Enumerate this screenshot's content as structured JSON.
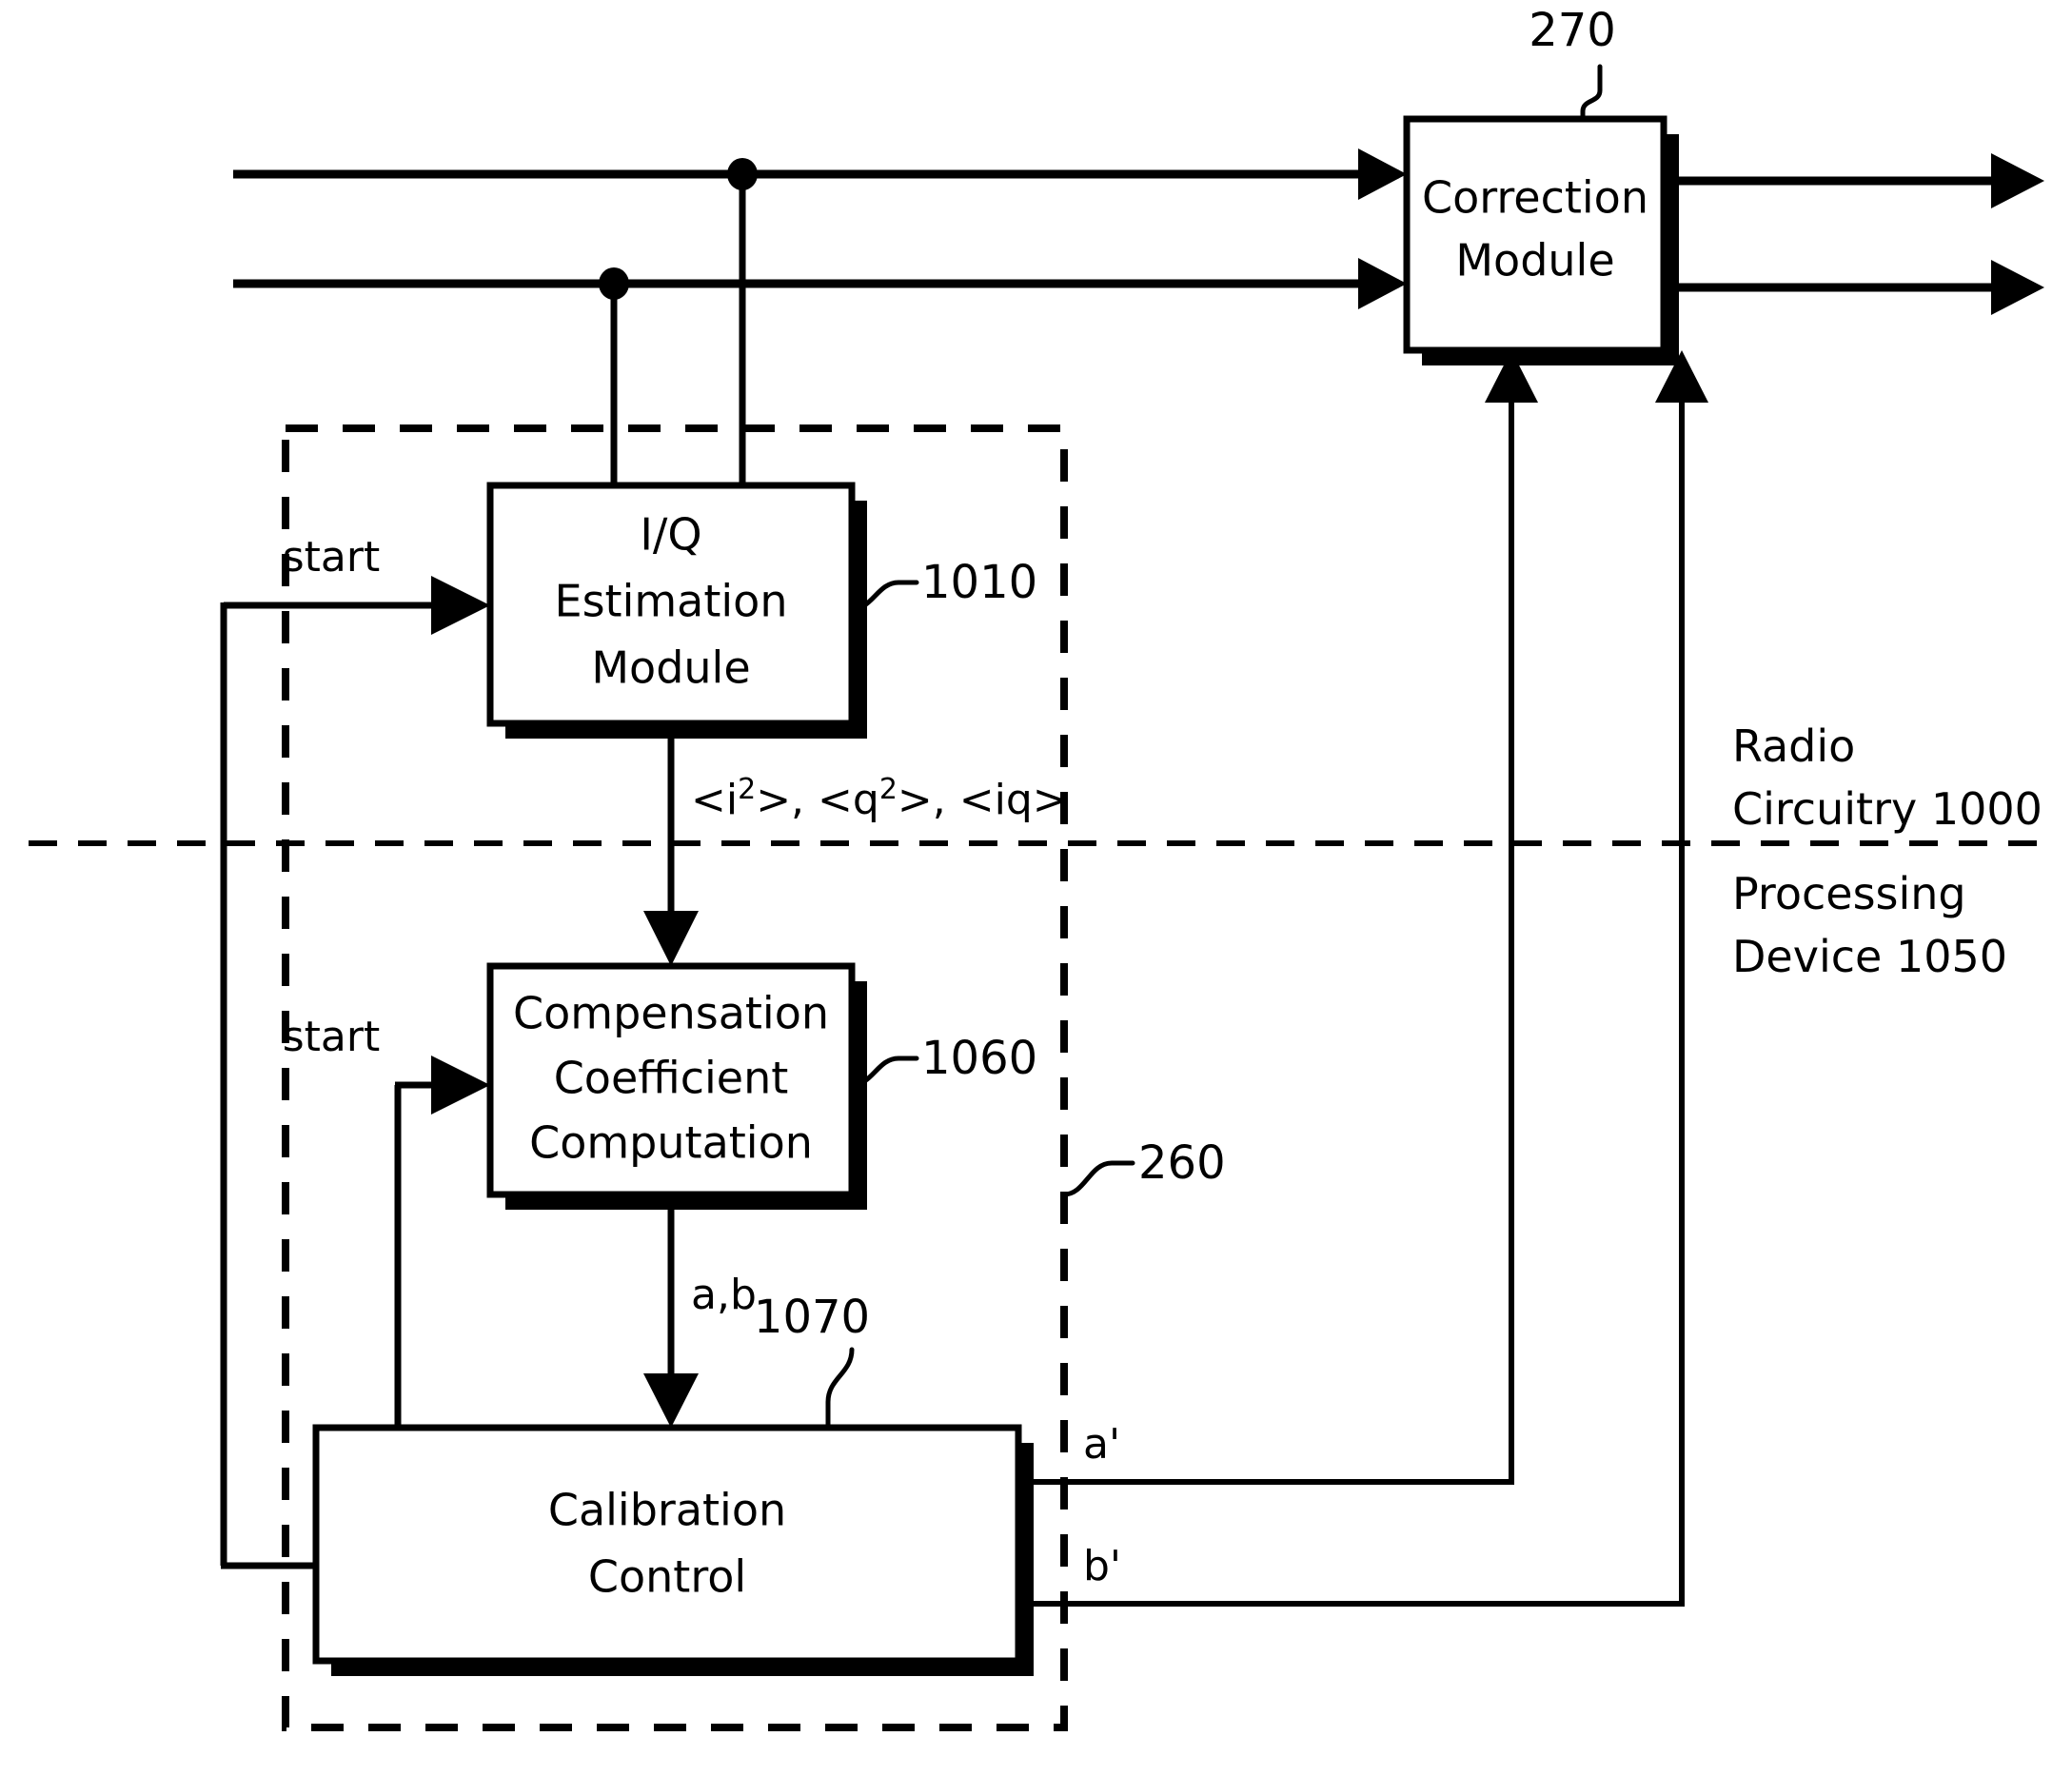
{
  "figure": {
    "title": "I/Q imbalance calibration block diagram",
    "ink_color": "#000000",
    "background_color": "#ffffff"
  },
  "blocks": {
    "correction_module": {
      "line1": "Correction",
      "line2": "Module",
      "ref": "270"
    },
    "iq_estimation_module": {
      "line1": "I/Q",
      "line2": "Estimation",
      "line3": "Module",
      "ref": "1010"
    },
    "compensation_coefficient_computation": {
      "line1": "Compensation",
      "line2": "Coefficient",
      "line3": "Computation",
      "ref": "1060"
    },
    "calibration_control": {
      "line1": "Calibration",
      "line2": "Control",
      "ref": "1070"
    }
  },
  "signals": {
    "start_iq": "start",
    "start_comp": "start",
    "estimates_prefix": "<i",
    "estimates_sup1": "2",
    "estimates_mid": ">, <q",
    "estimates_sup2": "2",
    "estimates_suffix": ">, <iq>",
    "estimates_plain": "<i2>, <q2>, <iq>",
    "coefficients": "a,b",
    "a_prime": "a'",
    "b_prime": "b'"
  },
  "regions": {
    "calibration_block_ref": "260",
    "radio_circuitry_line1": "Radio",
    "radio_circuitry_line2": "Circuitry 1000",
    "processing_device_line1": "Processing",
    "processing_device_line2": "Device 1050"
  }
}
